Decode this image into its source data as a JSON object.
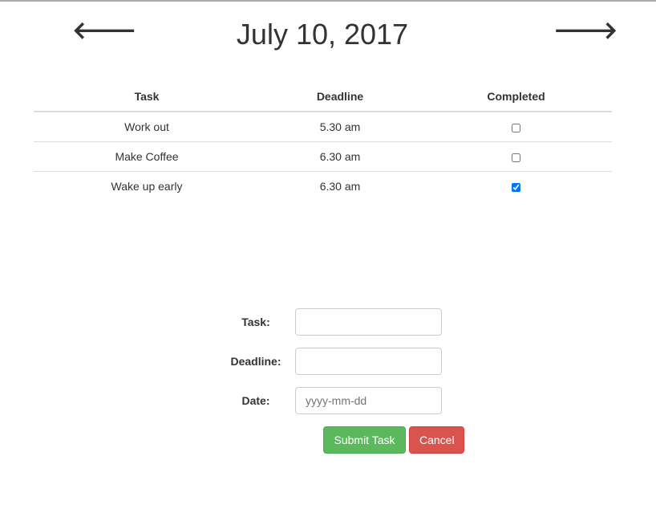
{
  "header": {
    "prev_icon": "arrow-left-icon",
    "next_icon": "arrow-right-icon",
    "title": "July 10, 2017"
  },
  "table": {
    "columns": [
      "Task",
      "Deadline",
      "Completed"
    ],
    "rows": [
      {
        "task": "Work out",
        "deadline": "5.30 am",
        "completed": false
      },
      {
        "task": "Make Coffee",
        "deadline": "6.30 am",
        "completed": false
      },
      {
        "task": "Wake up early",
        "deadline": "6.30 am",
        "completed": true
      }
    ]
  },
  "form": {
    "task_label": "Task:",
    "task_value": "",
    "deadline_label": "Deadline:",
    "deadline_value": "",
    "date_label": "Date:",
    "date_placeholder": "yyyy-mm-dd",
    "submit_label": "Submit Task",
    "cancel_label": "Cancel"
  }
}
